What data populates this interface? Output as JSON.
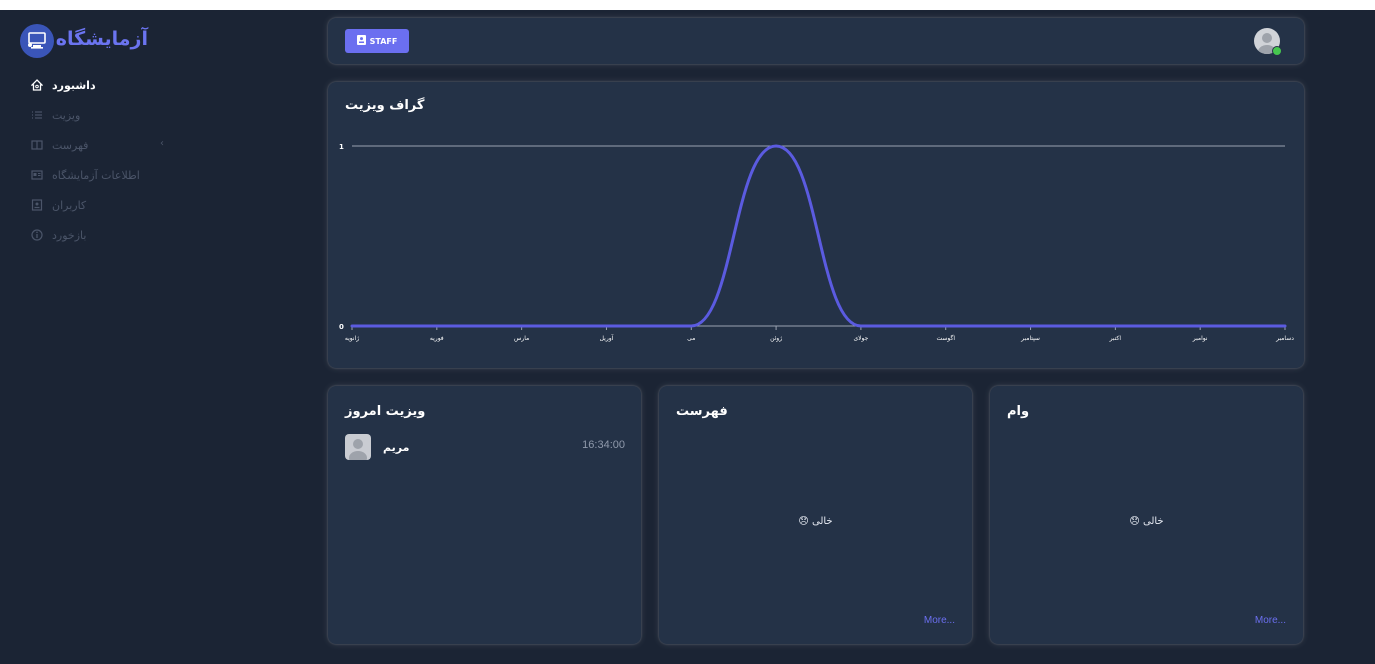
{
  "app": {
    "brand": "آزمایشگاه"
  },
  "sidebar": {
    "items": [
      {
        "label": "داشبورد",
        "icon": "home-icon",
        "active": true
      },
      {
        "label": "ویزیت",
        "icon": "list-icon",
        "active": false
      },
      {
        "label": "فهرست",
        "icon": "book-icon",
        "active": false,
        "has_submenu": true
      },
      {
        "label": "اطلاعات آزمایشگاه",
        "icon": "id-card-icon",
        "active": false
      },
      {
        "label": "کاربران",
        "icon": "user-badge-icon",
        "active": false
      },
      {
        "label": "بازخورد",
        "icon": "info-icon",
        "active": false
      }
    ]
  },
  "header": {
    "staff_label": "STAFF",
    "status": "online"
  },
  "chart": {
    "title": "گراف ویزیت"
  },
  "chart_data": {
    "type": "line",
    "categories": [
      "ژانویه",
      "فوریه",
      "مارس",
      "آوریل",
      "می",
      "ژوئن",
      "جولای",
      "اگوست",
      "سپتامبر",
      "اکتبر",
      "نوامبر",
      "دسامبر"
    ],
    "series": [
      {
        "values": [
          0,
          0,
          0,
          0,
          0,
          1,
          0,
          0,
          0,
          0,
          0,
          0
        ]
      }
    ],
    "ylim": [
      0,
      1
    ],
    "yticks": [
      "0",
      "1"
    ],
    "color": "#5b5be0",
    "grid": true
  },
  "cards": {
    "today_visits": {
      "title": "ویزیت امروز",
      "rows": [
        {
          "name": "مریم",
          "time": "16:34:00"
        }
      ]
    },
    "list": {
      "title": "فهرست",
      "empty_text": "خالی 😞",
      "more": "More..."
    },
    "loan": {
      "title": "وام",
      "empty_text": "خالی 😞",
      "more": "More..."
    }
  },
  "colors": {
    "background": "#1b2434",
    "card": "#243247",
    "accent": "#6b6ff0",
    "brand": "#6b74f0",
    "online": "#46c74f"
  }
}
